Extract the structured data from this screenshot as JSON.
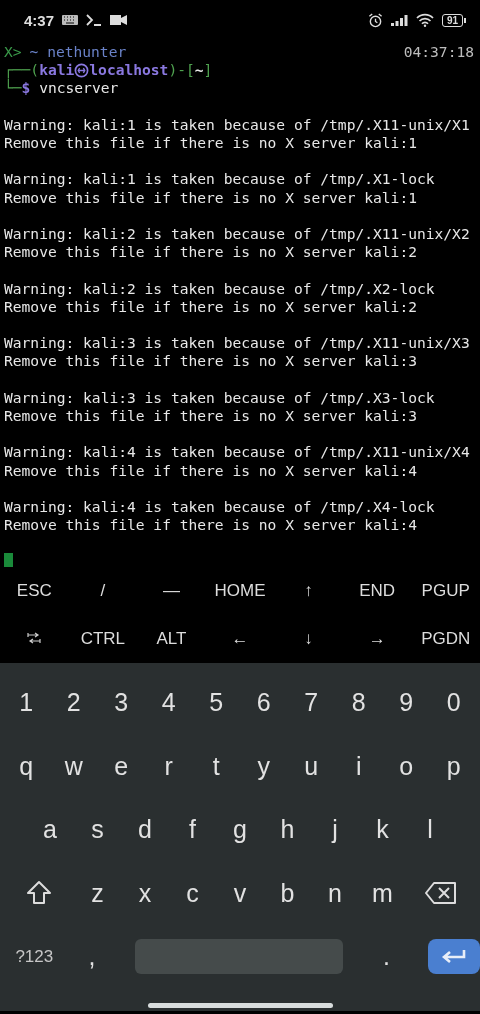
{
  "status_bar": {
    "time": "4:37",
    "battery": "91"
  },
  "terminal": {
    "header": {
      "mark": "X>",
      "title": "~ nethunter",
      "clock": "04:37:18"
    },
    "prompt_top": [
      {
        "text": "┌──(",
        "kind": "frame"
      },
      {
        "text": "kali",
        "kind": "user"
      },
      {
        "kind": "symbol"
      },
      {
        "text": "localhost",
        "kind": "user"
      },
      {
        "text": ")-[",
        "kind": "frame"
      },
      {
        "text": "~",
        "kind": "path"
      },
      {
        "text": "]",
        "kind": "frame"
      }
    ],
    "prompt_bottom": [
      {
        "text": "└─",
        "kind": "frame"
      },
      {
        "text": "$",
        "kind": "user"
      },
      {
        "text": " vncserver",
        "kind": "plain"
      }
    ],
    "output": [
      {
        "lines": [
          "Warning: kali:1 is taken because of /tmp/.X11-unix/X1",
          "Remove this file if there is no X server kali:1"
        ]
      },
      {
        "lines": [
          "Warning: kali:1 is taken because of /tmp/.X1-lock",
          "Remove this file if there is no X server kali:1"
        ]
      },
      {
        "lines": [
          "Warning: kali:2 is taken because of /tmp/.X11-unix/X2",
          "Remove this file if there is no X server kali:2"
        ]
      },
      {
        "lines": [
          "Warning: kali:2 is taken because of /tmp/.X2-lock",
          "Remove this file if there is no X server kali:2"
        ]
      },
      {
        "lines": [
          "Warning: kali:3 is taken because of /tmp/.X11-unix/X3",
          "Remove this file if there is no X server kali:3"
        ]
      },
      {
        "lines": [
          "Warning: kali:3 is taken because of /tmp/.X3-lock",
          "Remove this file if there is no X server kali:3"
        ]
      },
      {
        "lines": [
          "Warning: kali:4 is taken because of /tmp/.X11-unix/X4",
          "Remove this file if there is no X server kali:4"
        ]
      },
      {
        "lines": [
          "Warning: kali:4 is taken because of /tmp/.X4-lock",
          "Remove this file if there is no X server kali:4"
        ]
      }
    ]
  },
  "extra_keys": [
    [
      {
        "kind": "text",
        "label": "ESC"
      },
      {
        "kind": "text",
        "label": "/"
      },
      {
        "kind": "text",
        "label": "—"
      },
      {
        "kind": "text",
        "label": "HOME"
      },
      {
        "kind": "text",
        "label": "↑"
      },
      {
        "kind": "text",
        "label": "END"
      },
      {
        "kind": "text",
        "label": "PGUP"
      }
    ],
    [
      {
        "kind": "tab"
      },
      {
        "kind": "text",
        "label": "CTRL"
      },
      {
        "kind": "text",
        "label": "ALT"
      },
      {
        "kind": "text",
        "label": "←"
      },
      {
        "kind": "text",
        "label": "↓"
      },
      {
        "kind": "text",
        "label": "→"
      },
      {
        "kind": "text",
        "label": "PGDN"
      }
    ]
  ],
  "keyboard": {
    "rows": [
      [
        "1",
        "2",
        "3",
        "4",
        "5",
        "6",
        "7",
        "8",
        "9",
        "0"
      ],
      [
        "q",
        "w",
        "e",
        "r",
        "t",
        "y",
        "u",
        "i",
        "o",
        "p"
      ],
      [
        "a",
        "s",
        "d",
        "f",
        "g",
        "h",
        "j",
        "k",
        "l"
      ],
      [
        "z",
        "x",
        "c",
        "v",
        "b",
        "n",
        "m"
      ]
    ],
    "symbols_key": "?123",
    "comma": ",",
    "period": "."
  }
}
